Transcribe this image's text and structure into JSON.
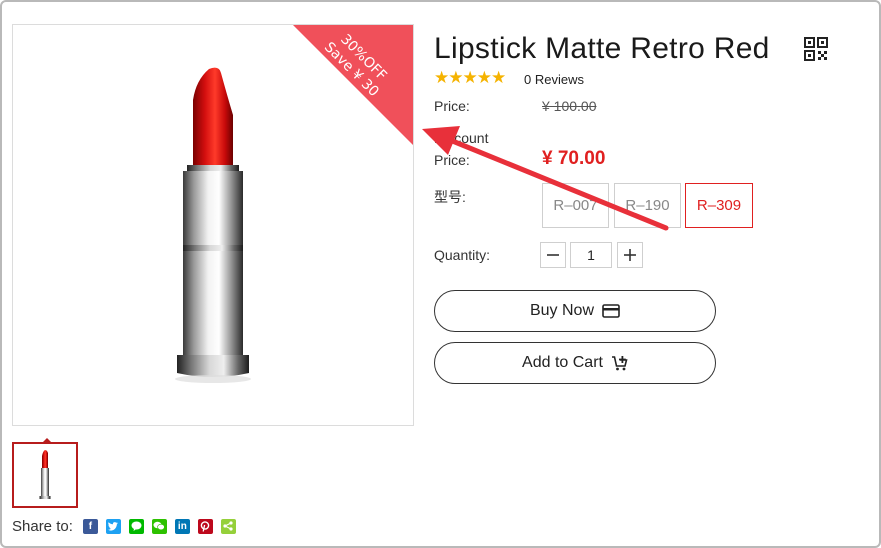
{
  "product": {
    "title": "Lipstick Matte Retro Red",
    "reviews": "0 Reviews",
    "rating_stars": 5,
    "badge": {
      "line1": "30%OFF",
      "line2": "Save ¥ 30",
      "color": "#f0505a"
    },
    "price_label": "Price:",
    "original_price": "¥ 100.00",
    "discount_label_line1": "Discount",
    "discount_label_line2": "Price:",
    "discount_price": "¥ 70.00",
    "model_label": "型号:",
    "models": [
      "R–007",
      "R–190",
      "R–309"
    ],
    "selected_model": "R–309",
    "quantity_label": "Quantity:",
    "quantity": "1",
    "buy_now": "Buy Now",
    "add_to_cart": "Add to Cart",
    "share_label": "Share to:"
  },
  "icons": {
    "qr": "qr-code-icon",
    "buy": "credit-card-icon",
    "cart": "cart-plus-icon",
    "share": [
      "facebook-icon",
      "twitter-icon",
      "line-icon",
      "wechat-icon",
      "linkedin-icon",
      "pinterest-icon",
      "share-icon"
    ]
  },
  "colors": {
    "accent": "#e02020",
    "star": "#f5b301",
    "annotation_arrow": "#e8303a"
  }
}
